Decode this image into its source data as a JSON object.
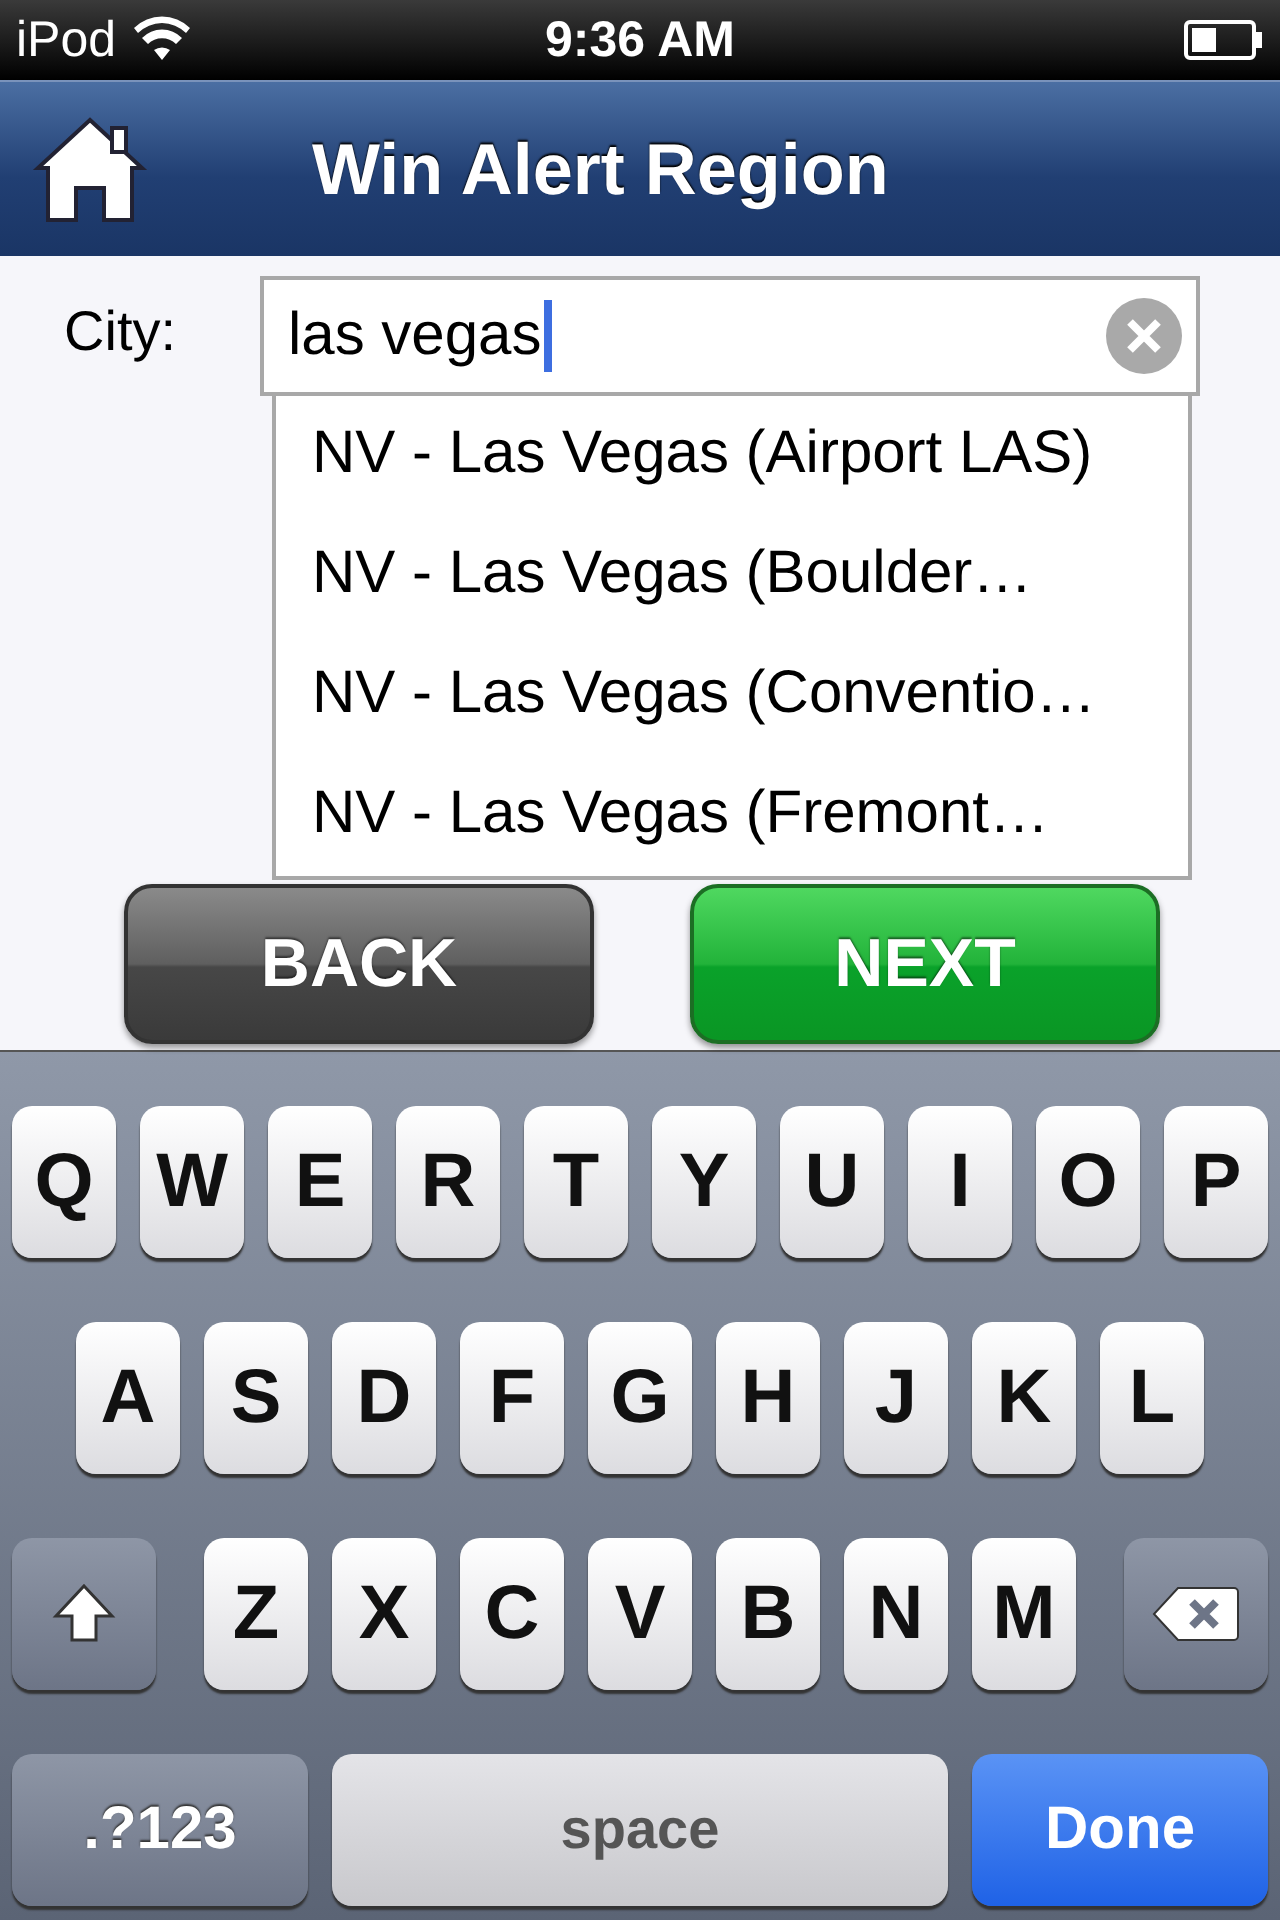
{
  "status_bar": {
    "carrier": "iPod",
    "time": "9:36 AM"
  },
  "nav_bar": {
    "title": "Win Alert Region"
  },
  "form": {
    "label": "City:",
    "value": "las vegas",
    "focused": true
  },
  "suggestions": [
    "NV - Las Vegas (Airport LAS)",
    "NV - Las Vegas (Boulder…",
    "NV - Las Vegas (Conventio…",
    "NV - Las Vegas (Fremont…"
  ],
  "buttons": [
    {
      "label": "BACK",
      "kind": "back"
    },
    {
      "label": "NEXT",
      "kind": "next"
    }
  ],
  "keyboard": {
    "rows": [
      {
        "keys": [
          {
            "kind": "letter",
            "label": "Q"
          },
          {
            "kind": "letter",
            "label": "W"
          },
          {
            "kind": "letter",
            "label": "E"
          },
          {
            "kind": "letter",
            "label": "R"
          },
          {
            "kind": "letter",
            "label": "T"
          },
          {
            "kind": "letter",
            "label": "Y"
          },
          {
            "kind": "letter",
            "label": "U"
          },
          {
            "kind": "letter",
            "label": "I"
          },
          {
            "kind": "letter",
            "label": "O"
          },
          {
            "kind": "letter",
            "label": "P"
          }
        ]
      },
      {
        "keys": [
          {
            "kind": "letter",
            "label": "A"
          },
          {
            "kind": "letter",
            "label": "S"
          },
          {
            "kind": "letter",
            "label": "D"
          },
          {
            "kind": "letter",
            "label": "F"
          },
          {
            "kind": "letter",
            "label": "G"
          },
          {
            "kind": "letter",
            "label": "H"
          },
          {
            "kind": "letter",
            "label": "J"
          },
          {
            "kind": "letter",
            "label": "K"
          },
          {
            "kind": "letter",
            "label": "L"
          }
        ]
      },
      {
        "keys": [
          {
            "kind": "shift"
          },
          {
            "kind": "letter",
            "label": "Z"
          },
          {
            "kind": "letter",
            "label": "X"
          },
          {
            "kind": "letter",
            "label": "C"
          },
          {
            "kind": "letter",
            "label": "V"
          },
          {
            "kind": "letter",
            "label": "B"
          },
          {
            "kind": "letter",
            "label": "N"
          },
          {
            "kind": "letter",
            "label": "M"
          },
          {
            "kind": "delete"
          }
        ]
      },
      {
        "keys": [
          {
            "kind": "mode",
            "label": ".?123"
          },
          {
            "kind": "space",
            "label": "space"
          },
          {
            "kind": "done",
            "label": "Done"
          }
        ]
      }
    ]
  }
}
